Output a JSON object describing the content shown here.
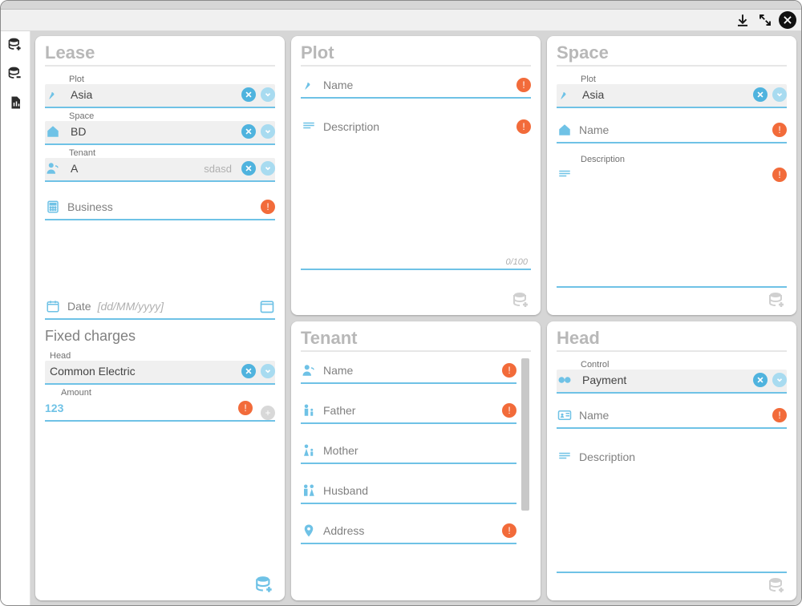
{
  "panels": {
    "plot": {
      "title": "Plot",
      "name_label": "Name",
      "desc_label": "Description",
      "counter": "0/100"
    },
    "space": {
      "title": "Space",
      "plot_label": "Plot",
      "plot_value": "Asia",
      "name_label": "Name",
      "desc_label": "Description"
    },
    "lease": {
      "title": "Lease",
      "plot_label": "Plot",
      "plot_value": "Asia",
      "space_label": "Space",
      "space_value": "BD",
      "tenant_label": "Tenant",
      "tenant_value": "A",
      "tenant_hint": "sdasd",
      "business_label": "Business",
      "date_label": "Date",
      "date_placeholder": "[dd/MM/yyyy]",
      "fixed_charges_title": "Fixed charges",
      "head_label": "Head",
      "head_value": "Common Electric",
      "amount_label": "Amount",
      "amount_placeholder": "123"
    },
    "tenant": {
      "title": "Tenant",
      "name_label": "Name",
      "father_label": "Father",
      "mother_label": "Mother",
      "husband_label": "Husband",
      "address_label": "Address"
    },
    "head": {
      "title": "Head",
      "control_label": "Control",
      "control_value": "Payment",
      "name_label": "Name",
      "desc_label": "Description"
    }
  }
}
